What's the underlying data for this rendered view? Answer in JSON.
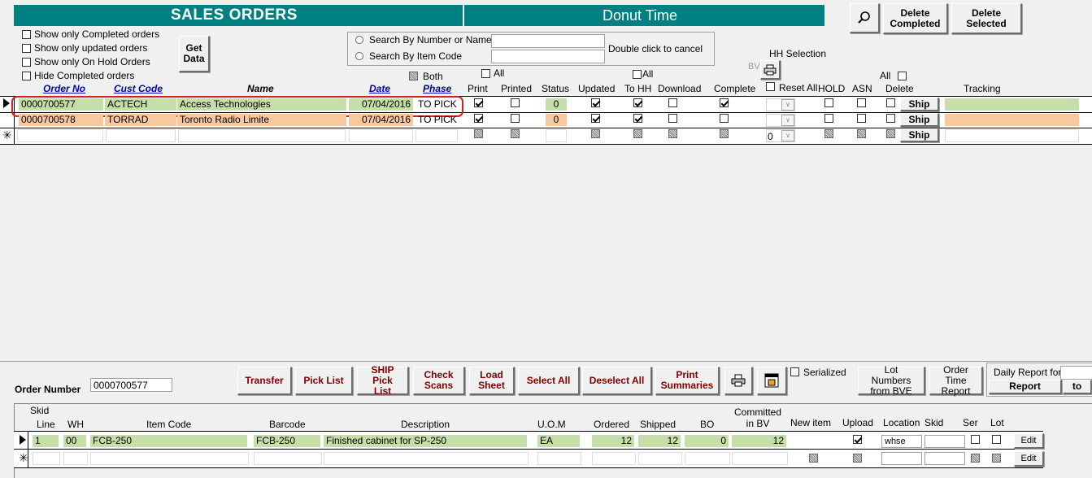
{
  "header": {
    "title": "SALES ORDERS",
    "company": "Donut Time",
    "delete_completed": "Delete Completed",
    "delete_selected": "Delete Selected"
  },
  "filters": {
    "show_completed": "Show only Completed orders",
    "show_updated": "Show only updated orders",
    "show_on_hold": "Show only On Hold Orders",
    "hide_completed": "Hide Completed orders",
    "get_data": "Get Data"
  },
  "search": {
    "by_number": "Search By Number or Name",
    "by_item": "Search By Item Code",
    "cancel_hint": "Double click to cancel"
  },
  "hh_selection": "HH Selection",
  "bv_label": "BV",
  "both_label": "Both",
  "all_label": "All",
  "reset_all": "Reset All",
  "columns": {
    "order_no": "Order No",
    "cust_code": "Cust Code",
    "name": "Name",
    "date": "Date",
    "phase": "Phase",
    "print": "Print",
    "printed": "Printed",
    "status": "Status",
    "updated": "Updated",
    "to_hh": "To HH",
    "download": "Download",
    "complete": "Complete",
    "hold": "HOLD",
    "asn": "ASN",
    "delete": "Delete",
    "tracking": "Tracking"
  },
  "orders": [
    {
      "order_no": "0000700577",
      "cust_code": "ACTECH",
      "name": "Access Technologies",
      "date": "07/04/2016",
      "phase": "TO PICK",
      "status": "0",
      "ship": "Ship"
    },
    {
      "order_no": "0000700578",
      "cust_code": "TORRAD",
      "name": "Toronto Radio Limite",
      "date": "07/04/2016",
      "phase": "TO PICK",
      "status": "0",
      "ship": "Ship"
    }
  ],
  "new_row": {
    "hh": "0",
    "ship": "Ship"
  },
  "bottom": {
    "order_number_label": "Order Number",
    "order_number_value": "0000700577",
    "transfer": "Transfer",
    "pick_list": "Pick List",
    "ship_pick_list": "SHIP Pick List",
    "check_scans": "Check Scans",
    "load_sheet": "Load Sheet",
    "select_all": "Select All",
    "deselect_all": "Deselect All",
    "print_summaries": "Print Summaries",
    "serialized": "Serialized",
    "lot_numbers": "Lot Numbers from BVE",
    "order_time_report": "Order Time Report",
    "daily_report_for": "Daily Report for:",
    "report": "Report",
    "to": "to"
  },
  "lines_columns": {
    "skid_top": "Skid",
    "line": "Line",
    "wh": "WH",
    "item_code": "Item Code",
    "barcode": "Barcode",
    "description": "Description",
    "uom": "U.O.M",
    "ordered": "Ordered",
    "shipped": "Shipped",
    "bo": "BO",
    "committed": "Committed in BV",
    "new_item": "New item",
    "upload": "Upload",
    "location": "Location",
    "skid": "Skid",
    "ser": "Ser",
    "lot": "Lot"
  },
  "lines": [
    {
      "line": "1",
      "wh": "00",
      "item_code": "FCB-250",
      "barcode": "FCB-250",
      "description": "Finished cabinet for SP-250",
      "uom": "EA",
      "ordered": "12",
      "shipped": "12",
      "bo": "0",
      "committed": "12",
      "location": "whse",
      "edit": "Edit"
    }
  ],
  "new_line": {
    "edit": "Edit"
  },
  "colors": {
    "teal": "#008080",
    "green_cell": "#c6dea8",
    "orange_cell": "#f8c8a0",
    "link_blue": "#0000c0",
    "button_red": "#800000"
  }
}
